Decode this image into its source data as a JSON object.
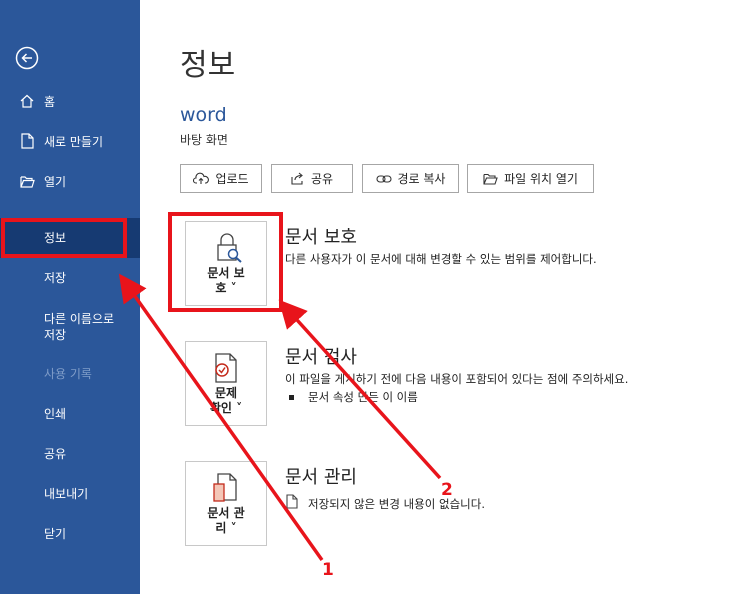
{
  "sidebar": {
    "items": [
      {
        "label": "홈"
      },
      {
        "label": "새로 만들기"
      },
      {
        "label": "열기"
      },
      {
        "label": "정보"
      },
      {
        "label": "저장"
      },
      {
        "label": "다른 이름으로"
      },
      {
        "label": "저장"
      },
      {
        "label": "사용 기록"
      },
      {
        "label": "인쇄"
      },
      {
        "label": "공유"
      },
      {
        "label": "내보내기"
      },
      {
        "label": "닫기"
      }
    ]
  },
  "page": {
    "title": "정보",
    "doc_name": "word",
    "doc_location": "바탕 화면"
  },
  "toolbar": {
    "upload": "업로드",
    "share": "공유",
    "copy_path": "경로 복사",
    "open_location": "파일 위치 열기"
  },
  "sections": [
    {
      "button_line1": "문서 보",
      "button_line2": "호 ˅",
      "title": "문서 보호",
      "desc": "다른 사용자가 이 문서에 대해 변경할 수 있는 범위를 제어합니다."
    },
    {
      "button_line1": "문제",
      "button_line2": "확인 ˅",
      "title": "문서 검사",
      "desc": "이 파일을 게시하기 전에 다음 내용이 포함되어 있다는 점에 주의하세요.",
      "bullet": "문서 속성 만든 이 이름"
    },
    {
      "button_line1": "문서 관",
      "button_line2": "리 ˅",
      "title": "문서 관리",
      "desc": "저장되지 않은 변경 내용이 없습니다."
    }
  ],
  "annotations": {
    "one": "1",
    "two": "2"
  },
  "colors": {
    "sidebar": "#2b579a",
    "selected": "#163a72",
    "annotation": "#e8141b"
  }
}
